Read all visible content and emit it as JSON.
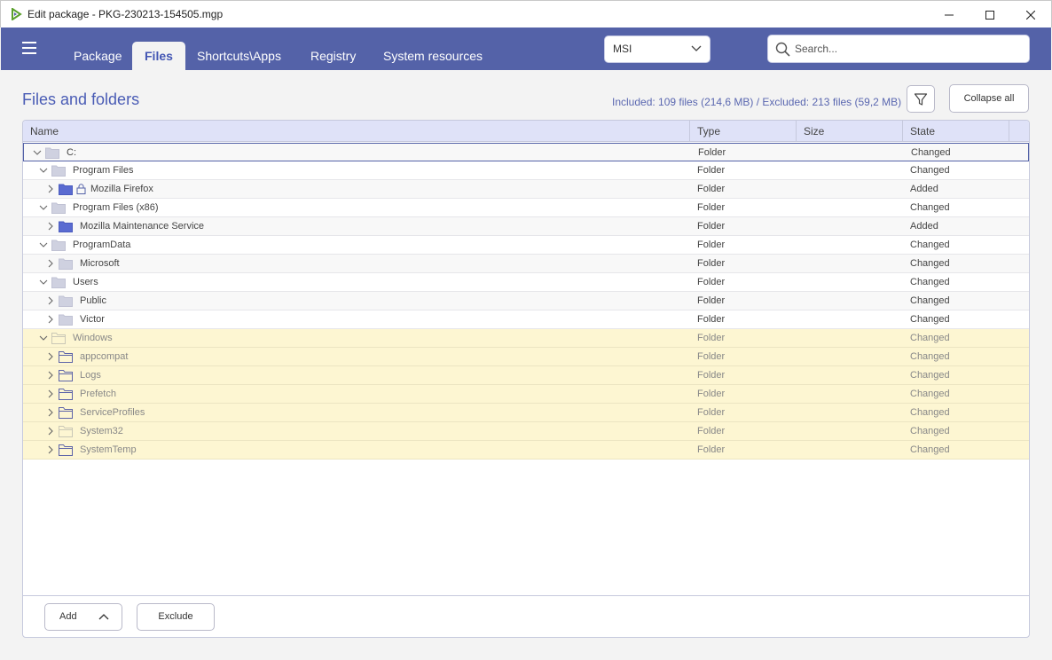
{
  "window": {
    "title": "Edit package - PKG-230213-154505.mgp"
  },
  "nav": {
    "tabs": [
      {
        "label": "Package",
        "active": false
      },
      {
        "label": "Files",
        "active": true
      },
      {
        "label": "Shortcuts\\Apps",
        "active": false
      },
      {
        "label": "Registry",
        "active": false
      },
      {
        "label": "System resources",
        "active": false
      }
    ],
    "package_type": "MSI",
    "search_placeholder": "Search..."
  },
  "section": {
    "title": "Files and folders",
    "summary": "Included: 109 files (214,6 MB) / Excluded: 213 files (59,2 MB)",
    "collapse_label": "Collapse all"
  },
  "columns": [
    "Name",
    "Type",
    "Size",
    "State"
  ],
  "rows": [
    {
      "name": "C:",
      "level": 0,
      "expanded": true,
      "icon": "folder-gray-icon",
      "type": "Folder",
      "size": "",
      "state": "Changed",
      "selected": true,
      "excluded": false,
      "locked": false
    },
    {
      "name": "Program Files",
      "level": 1,
      "expanded": true,
      "icon": "folder-gray-icon",
      "type": "Folder",
      "size": "",
      "state": "Changed",
      "selected": false,
      "excluded": false,
      "locked": false
    },
    {
      "name": "Mozilla Firefox",
      "level": 2,
      "expanded": false,
      "icon": "folder-blue-icon",
      "type": "Folder",
      "size": "",
      "state": "Added",
      "selected": false,
      "excluded": false,
      "locked": true
    },
    {
      "name": "Program Files (x86)",
      "level": 1,
      "expanded": true,
      "icon": "folder-gray-icon",
      "type": "Folder",
      "size": "",
      "state": "Changed",
      "selected": false,
      "excluded": false,
      "locked": false
    },
    {
      "name": "Mozilla Maintenance Service",
      "level": 2,
      "expanded": false,
      "icon": "folder-blue-icon",
      "type": "Folder",
      "size": "",
      "state": "Added",
      "selected": false,
      "excluded": false,
      "locked": false
    },
    {
      "name": "ProgramData",
      "level": 1,
      "expanded": true,
      "icon": "folder-gray-icon",
      "type": "Folder",
      "size": "",
      "state": "Changed",
      "selected": false,
      "excluded": false,
      "locked": false
    },
    {
      "name": "Microsoft",
      "level": 2,
      "expanded": false,
      "icon": "folder-gray-icon",
      "type": "Folder",
      "size": "",
      "state": "Changed",
      "selected": false,
      "excluded": false,
      "locked": false
    },
    {
      "name": "Users",
      "level": 1,
      "expanded": true,
      "icon": "folder-gray-icon",
      "type": "Folder",
      "size": "",
      "state": "Changed",
      "selected": false,
      "excluded": false,
      "locked": false
    },
    {
      "name": "Public",
      "level": 2,
      "expanded": false,
      "icon": "folder-gray-icon",
      "type": "Folder",
      "size": "",
      "state": "Changed",
      "selected": false,
      "excluded": false,
      "locked": false
    },
    {
      "name": "Victor",
      "level": 2,
      "expanded": false,
      "icon": "folder-gray-icon",
      "type": "Folder",
      "size": "",
      "state": "Changed",
      "selected": false,
      "excluded": false,
      "locked": false
    },
    {
      "name": "Windows",
      "level": 1,
      "expanded": true,
      "icon": "folder-outline-light-icon",
      "type": "Folder",
      "size": "",
      "state": "Changed",
      "selected": false,
      "excluded": true,
      "locked": false
    },
    {
      "name": "appcompat",
      "level": 2,
      "expanded": false,
      "icon": "folder-outline-icon",
      "type": "Folder",
      "size": "",
      "state": "Changed",
      "selected": false,
      "excluded": true,
      "locked": false
    },
    {
      "name": "Logs",
      "level": 2,
      "expanded": false,
      "icon": "folder-outline-icon",
      "type": "Folder",
      "size": "",
      "state": "Changed",
      "selected": false,
      "excluded": true,
      "locked": false
    },
    {
      "name": "Prefetch",
      "level": 2,
      "expanded": false,
      "icon": "folder-outline-icon",
      "type": "Folder",
      "size": "",
      "state": "Changed",
      "selected": false,
      "excluded": true,
      "locked": false
    },
    {
      "name": "ServiceProfiles",
      "level": 2,
      "expanded": false,
      "icon": "folder-outline-icon",
      "type": "Folder",
      "size": "",
      "state": "Changed",
      "selected": false,
      "excluded": true,
      "locked": false
    },
    {
      "name": "System32",
      "level": 2,
      "expanded": false,
      "icon": "folder-outline-light-icon",
      "type": "Folder",
      "size": "",
      "state": "Changed",
      "selected": false,
      "excluded": true,
      "locked": false
    },
    {
      "name": "SystemTemp",
      "level": 2,
      "expanded": false,
      "icon": "folder-outline-icon",
      "type": "Folder",
      "size": "",
      "state": "Changed",
      "selected": false,
      "excluded": true,
      "locked": false
    }
  ],
  "footer": {
    "add_label": "Add",
    "exclude_label": "Exclude"
  },
  "colors": {
    "accent": "#5462a8",
    "header_text": "#4a5cb5",
    "excluded_row": "#fdf6d2",
    "column_header": "#dfe2f8"
  }
}
